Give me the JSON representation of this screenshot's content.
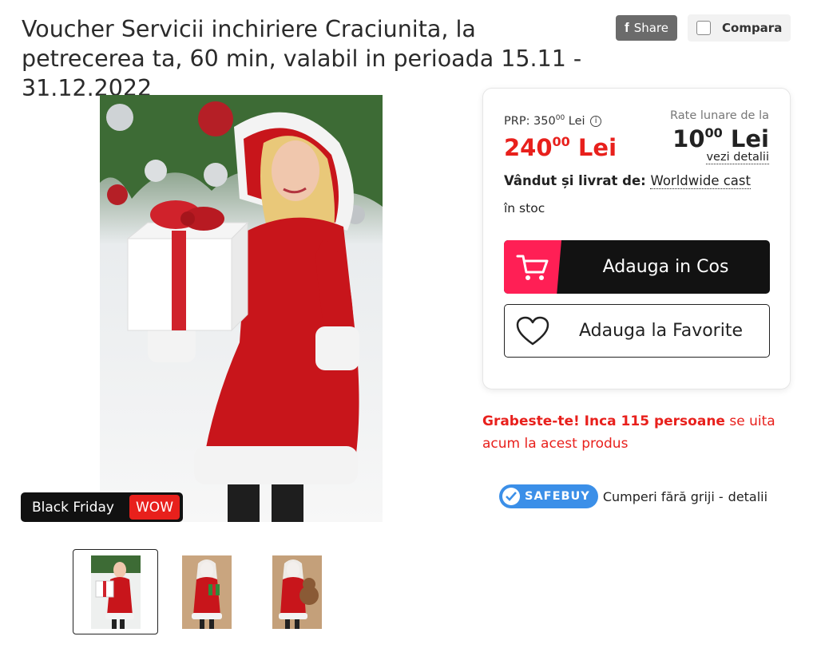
{
  "product": {
    "title": "Voucher Servicii inchiriere Craciunita, la petrecerea ta, 60 min, valabil in perioada 15.11 - 31.12.2022"
  },
  "header": {
    "share_label": "Share",
    "compare_label": "Compara"
  },
  "gallery": {
    "badge_text": "Black Friday",
    "badge_tag": "WOW",
    "thumbnails": 3
  },
  "pricing": {
    "prp_label": "PRP: 350",
    "prp_decimals": "00",
    "prp_currency": "Lei",
    "price_integer": "240",
    "price_decimals": "00",
    "price_currency": "Lei",
    "rate_label": "Rate lunare de la",
    "rate_integer": "10",
    "rate_decimals": "00",
    "rate_currency": "Lei",
    "rate_link": "vezi detalii"
  },
  "seller": {
    "label": "Vândut și livrat de:",
    "name": "Worldwide cast"
  },
  "stock": "în stoc",
  "actions": {
    "cart_label": "Adauga in Cos",
    "favorite_label": "Adauga la Favorite"
  },
  "urgency": {
    "bold": "Grabeste-te! Inca 115 persoane",
    "rest": "se uita acum la acest produs"
  },
  "safebuy": {
    "badge": "SAFEBUY",
    "text": "Cumperi fără griji -",
    "link": "detalii"
  },
  "colors": {
    "accent_red": "#e8201c",
    "cart_pink": "#ff1f55",
    "safebuy_blue": "#3b8fe8"
  }
}
